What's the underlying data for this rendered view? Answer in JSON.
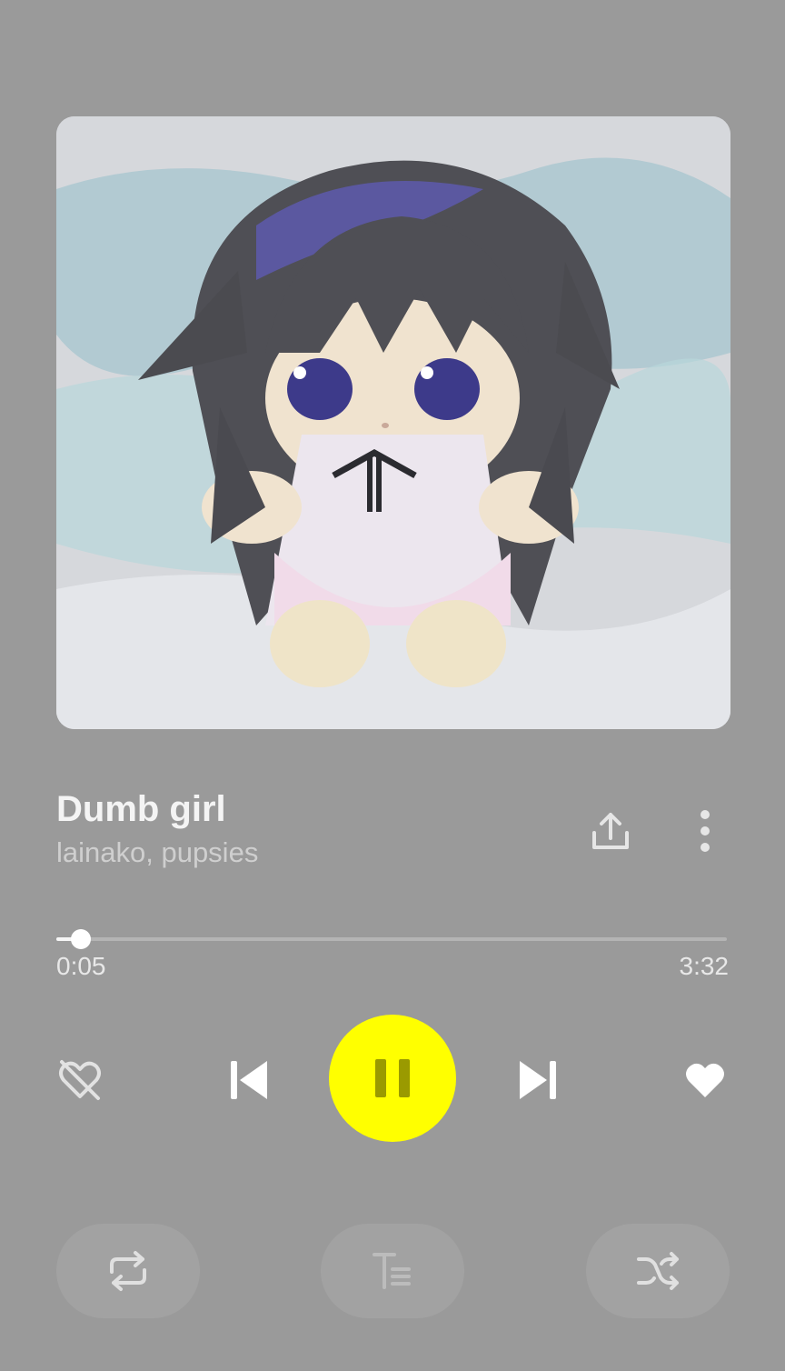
{
  "track": {
    "title": "Dumb girl",
    "artist": "lainako, pupsies"
  },
  "progress": {
    "elapsed": "0:05",
    "total": "3:32",
    "fraction": 0.036
  },
  "icons": {
    "artwork": "album-cover-plush-doll",
    "share": "share-icon",
    "more": "more-vertical-icon",
    "dislike": "heart-broken-icon",
    "previous": "skip-previous-icon",
    "play_pause": "pause-icon",
    "next": "skip-next-icon",
    "like": "heart-filled-icon",
    "repeat": "repeat-icon",
    "lyrics": "lyrics-icon",
    "shuffle": "shuffle-icon"
  },
  "colors": {
    "background": "#9a9a9a",
    "accent": "#ffff00",
    "text_primary": "#f4f4f4",
    "text_secondary": "#cfcfcf"
  },
  "state": {
    "playing": true,
    "liked": true
  }
}
